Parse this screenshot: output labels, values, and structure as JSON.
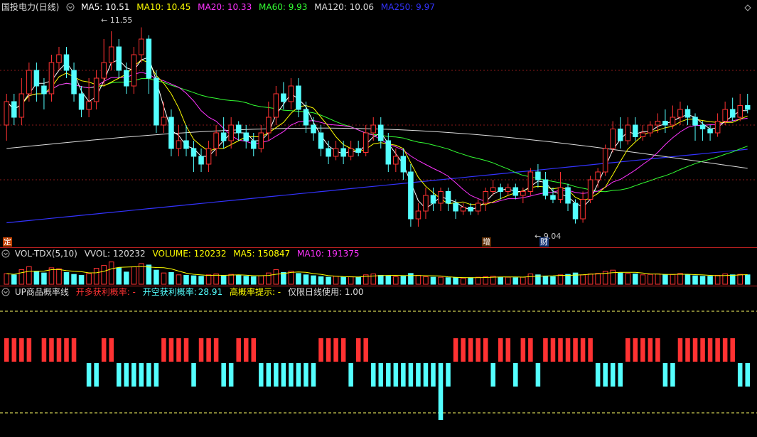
{
  "main": {
    "title": "国投电力(日线)",
    "ma": [
      {
        "label": "MA5: 10.51",
        "color": "#ffffff"
      },
      {
        "label": "MA10: 10.45",
        "color": "#ffff00"
      },
      {
        "label": "MA20: 10.33",
        "color": "#ff33ff"
      },
      {
        "label": "MA60: 9.93",
        "color": "#33ff33"
      },
      {
        "label": "MA120: 10.06",
        "color": "#dddddd"
      },
      {
        "label": "MA250: 9.97",
        "color": "#3333ff"
      }
    ],
    "high_label": "11.55",
    "low_label": "9.04",
    "tags": {
      "ding": "定",
      "zeng": "增",
      "cai": "财"
    }
  },
  "volume": {
    "name": "VOL-TDX(5,10)",
    "vvol": "VVOL: 120232",
    "volume": "VOLUME: 120232",
    "ma5": "MA5: 150847",
    "ma10": "MA10: 191375"
  },
  "indicator": {
    "name": "UP商品概率线",
    "long": "开多获利概率: -",
    "short_label": "开空获利概率:",
    "short_value": "28.91",
    "hint": "高概率提示: -",
    "note": "仅限日线使用: 1.00"
  },
  "colors": {
    "up": "#ff3232",
    "down": "#54ffff",
    "ma5": "#ffffff",
    "ma10": "#ffff00",
    "ma20": "#ff33ff",
    "ma60": "#33ff33",
    "ma120": "#dddddd",
    "ma250": "#3333ff",
    "grid": "#8a1a1a",
    "dash": "#ffff66"
  },
  "candles": [
    [
      10.3,
      10.6,
      10.7,
      10.1
    ],
    [
      10.6,
      10.4,
      10.7,
      10.3
    ],
    [
      10.4,
      10.7,
      10.9,
      10.3
    ],
    [
      10.7,
      11.0,
      11.1,
      10.6
    ],
    [
      11.0,
      10.8,
      11.1,
      10.6
    ],
    [
      10.8,
      10.7,
      10.9,
      10.5
    ],
    [
      10.7,
      11.1,
      11.2,
      10.6
    ],
    [
      11.1,
      11.2,
      11.3,
      11.0
    ],
    [
      11.2,
      11.0,
      11.3,
      10.9
    ],
    [
      11.0,
      10.7,
      11.1,
      10.6
    ],
    [
      10.7,
      10.5,
      10.8,
      10.4
    ],
    [
      10.5,
      10.6,
      10.9,
      10.4
    ],
    [
      10.6,
      10.9,
      11.0,
      10.5
    ],
    [
      10.9,
      11.1,
      11.4,
      10.8
    ],
    [
      11.1,
      11.3,
      11.5,
      11.0
    ],
    [
      11.3,
      11.0,
      11.4,
      10.9
    ],
    [
      11.0,
      10.8,
      11.1,
      10.7
    ],
    [
      10.8,
      11.2,
      11.3,
      10.7
    ],
    [
      11.2,
      11.4,
      11.55,
      11.1
    ],
    [
      11.4,
      10.9,
      11.45,
      10.7
    ],
    [
      10.9,
      10.3,
      11.0,
      10.2
    ],
    [
      10.3,
      10.4,
      10.6,
      10.2
    ],
    [
      10.4,
      10.0,
      10.5,
      9.9
    ],
    [
      10.0,
      10.1,
      10.3,
      9.9
    ],
    [
      10.1,
      10.0,
      10.3,
      9.9
    ],
    [
      10.0,
      9.9,
      10.1,
      9.7
    ],
    [
      9.9,
      9.8,
      10.0,
      9.7
    ],
    [
      9.8,
      10.0,
      10.1,
      9.7
    ],
    [
      10.0,
      10.2,
      10.3,
      9.9
    ],
    [
      10.2,
      10.1,
      10.4,
      10.0
    ],
    [
      10.1,
      10.3,
      10.4,
      10.0
    ],
    [
      10.3,
      10.2,
      10.35,
      10.1
    ],
    [
      10.2,
      10.1,
      10.3,
      10.0
    ],
    [
      10.1,
      10.0,
      10.2,
      9.9
    ],
    [
      10.0,
      10.2,
      10.3,
      9.95
    ],
    [
      10.2,
      10.4,
      10.6,
      10.1
    ],
    [
      10.4,
      10.7,
      10.8,
      10.3
    ],
    [
      10.7,
      10.6,
      10.85,
      10.5
    ],
    [
      10.6,
      10.8,
      10.9,
      10.5
    ],
    [
      10.8,
      10.5,
      10.9,
      10.4
    ],
    [
      10.5,
      10.3,
      10.6,
      10.2
    ],
    [
      10.3,
      10.2,
      10.4,
      10.1
    ],
    [
      10.2,
      10.0,
      10.3,
      9.9
    ],
    [
      10.0,
      9.9,
      10.1,
      9.8
    ],
    [
      9.9,
      10.0,
      10.1,
      9.85
    ],
    [
      10.0,
      9.9,
      10.1,
      9.8
    ],
    [
      9.9,
      10.0,
      10.1,
      9.85
    ],
    [
      10.0,
      9.95,
      10.1,
      9.9
    ],
    [
      9.95,
      10.2,
      10.3,
      9.9
    ],
    [
      10.2,
      10.3,
      10.4,
      10.1
    ],
    [
      10.3,
      10.1,
      10.4,
      10.0
    ],
    [
      10.1,
      9.8,
      10.2,
      9.7
    ],
    [
      9.8,
      9.9,
      10.0,
      9.7
    ],
    [
      9.9,
      9.7,
      10.0,
      9.6
    ],
    [
      9.7,
      9.1,
      9.8,
      9.0
    ],
    [
      9.1,
      9.2,
      9.3,
      9.0
    ],
    [
      9.2,
      9.4,
      9.5,
      9.1
    ],
    [
      9.4,
      9.3,
      9.5,
      9.2
    ],
    [
      9.3,
      9.45,
      9.5,
      9.2
    ],
    [
      9.45,
      9.3,
      9.5,
      9.2
    ],
    [
      9.3,
      9.2,
      9.35,
      9.1
    ],
    [
      9.2,
      9.25,
      9.3,
      9.15
    ],
    [
      9.25,
      9.2,
      9.3,
      9.15
    ],
    [
      9.2,
      9.3,
      9.35,
      9.15
    ],
    [
      9.3,
      9.45,
      9.5,
      9.2
    ],
    [
      9.45,
      9.5,
      9.6,
      9.4
    ],
    [
      9.5,
      9.45,
      9.55,
      9.35
    ],
    [
      9.45,
      9.5,
      9.55,
      9.4
    ],
    [
      9.5,
      9.4,
      9.55,
      9.35
    ],
    [
      9.4,
      9.45,
      9.5,
      9.3
    ],
    [
      9.45,
      9.7,
      9.75,
      9.4
    ],
    [
      9.7,
      9.6,
      9.8,
      9.5
    ],
    [
      9.6,
      9.4,
      9.7,
      9.35
    ],
    [
      9.4,
      9.35,
      9.5,
      9.3
    ],
    [
      9.35,
      9.5,
      9.7,
      9.3
    ],
    [
      9.5,
      9.3,
      9.55,
      9.2
    ],
    [
      9.3,
      9.1,
      9.35,
      9.04
    ],
    [
      9.1,
      9.35,
      9.45,
      9.05
    ],
    [
      9.35,
      9.6,
      9.65,
      9.3
    ],
    [
      9.6,
      9.7,
      9.75,
      9.5
    ],
    [
      9.7,
      10.0,
      10.05,
      9.65
    ],
    [
      10.0,
      10.25,
      10.35,
      9.95
    ],
    [
      10.25,
      10.1,
      10.4,
      10.0
    ],
    [
      10.1,
      10.3,
      10.4,
      10.05
    ],
    [
      10.3,
      10.15,
      10.4,
      10.1
    ],
    [
      10.15,
      10.2,
      10.3,
      10.1
    ],
    [
      10.2,
      10.3,
      10.35,
      10.15
    ],
    [
      10.3,
      10.35,
      10.45,
      10.2
    ],
    [
      10.35,
      10.3,
      10.5,
      10.2
    ],
    [
      10.3,
      10.4,
      10.55,
      10.25
    ],
    [
      10.4,
      10.5,
      10.6,
      10.3
    ],
    [
      10.5,
      10.4,
      10.55,
      10.3
    ],
    [
      10.4,
      10.3,
      10.45,
      10.1
    ],
    [
      10.3,
      10.25,
      10.35,
      10.1
    ],
    [
      10.25,
      10.2,
      10.3,
      10.1
    ],
    [
      10.2,
      10.35,
      10.45,
      10.15
    ],
    [
      10.35,
      10.5,
      10.6,
      10.3
    ],
    [
      10.5,
      10.4,
      10.65,
      10.35
    ],
    [
      10.4,
      10.55,
      10.7,
      10.35
    ],
    [
      10.55,
      10.5,
      10.7,
      10.45
    ]
  ],
  "volumes": [
    0.45,
    0.4,
    0.62,
    0.75,
    0.55,
    0.48,
    0.7,
    0.66,
    0.5,
    0.42,
    0.38,
    0.46,
    0.68,
    0.8,
    0.95,
    0.7,
    0.52,
    0.74,
    0.88,
    0.82,
    0.6,
    0.48,
    0.5,
    0.4,
    0.38,
    0.36,
    0.34,
    0.4,
    0.44,
    0.36,
    0.42,
    0.38,
    0.34,
    0.32,
    0.36,
    0.48,
    0.62,
    0.5,
    0.56,
    0.46,
    0.4,
    0.36,
    0.32,
    0.3,
    0.34,
    0.3,
    0.32,
    0.3,
    0.4,
    0.44,
    0.38,
    0.36,
    0.32,
    0.34,
    0.46,
    0.38,
    0.32,
    0.3,
    0.3,
    0.28,
    0.28,
    0.26,
    0.28,
    0.3,
    0.32,
    0.34,
    0.3,
    0.3,
    0.28,
    0.3,
    0.44,
    0.4,
    0.34,
    0.32,
    0.4,
    0.42,
    0.48,
    0.4,
    0.44,
    0.46,
    0.55,
    0.6,
    0.48,
    0.46,
    0.44,
    0.4,
    0.42,
    0.44,
    0.4,
    0.42,
    0.46,
    0.4,
    0.36,
    0.34,
    0.34,
    0.38,
    0.44,
    0.4,
    0.42,
    0.4
  ],
  "prob": [
    1,
    1,
    1,
    1,
    0,
    1,
    1,
    1,
    1,
    1,
    0,
    -1,
    -1,
    1,
    1,
    -1,
    -1,
    -1,
    -1,
    -1,
    -1,
    1,
    1,
    1,
    1,
    -1,
    1,
    1,
    1,
    -1,
    -1,
    1,
    1,
    1,
    -1,
    -1,
    -1,
    -1,
    -1,
    -1,
    -1,
    -1,
    1,
    1,
    1,
    1,
    -1,
    1,
    1,
    -1,
    -1,
    -1,
    -1,
    -1,
    -1,
    -1,
    -1,
    -1,
    -1,
    -1,
    1,
    1,
    1,
    1,
    1,
    -1,
    1,
    1,
    -1,
    1,
    1,
    -1,
    1,
    1,
    1,
    1,
    1,
    1,
    1,
    -1,
    -1,
    -1,
    -1,
    1,
    1,
    1,
    1,
    1,
    -1,
    -1,
    1,
    1,
    1,
    1,
    1,
    1,
    1,
    1,
    -1,
    -1
  ]
}
